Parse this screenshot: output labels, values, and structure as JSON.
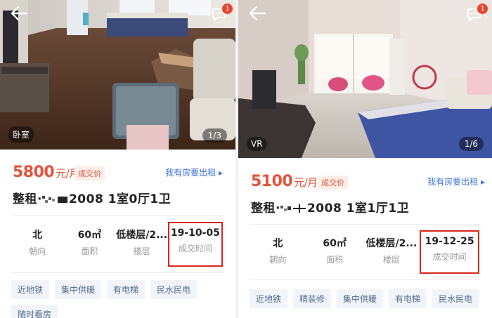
{
  "listings": [
    {
      "photo": {
        "room_tag": "卧室",
        "pager": "1/3"
      },
      "message_badge": "1",
      "price_value": "5800",
      "price_unit": "元/月",
      "deal_tag": "成交价",
      "rent_link": "我有房要出租 ▸",
      "title_prefix": "整租·",
      "title_suffix": "2008 1室0厅1卫",
      "stats": [
        {
          "value": "北",
          "label": "朝向"
        },
        {
          "value": "60㎡",
          "label": "面积"
        },
        {
          "value": "低楼层/2...",
          "label": "楼层"
        },
        {
          "value": "19-10-05",
          "label": "成交时间"
        }
      ],
      "tags": [
        "近地铁",
        "集中供暖",
        "有电梯",
        "民水民电",
        "随时看房"
      ]
    },
    {
      "photo": {
        "room_tag": "VR",
        "pager": "1/6"
      },
      "message_badge": "1",
      "price_value": "5100",
      "price_unit": "元/月",
      "deal_tag": "成交价",
      "rent_link": "我有房要出租 ▸",
      "title_prefix": "整租·",
      "title_suffix": "2008 1室1厅1卫",
      "stats": [
        {
          "value": "北",
          "label": "朝向"
        },
        {
          "value": "60㎡",
          "label": "面积"
        },
        {
          "value": "低楼层/2...",
          "label": "楼层"
        },
        {
          "value": "19-12-25",
          "label": "成交时间"
        }
      ],
      "tags": [
        "近地铁",
        "精装修",
        "集中供暖",
        "有电梯",
        "民水民电"
      ]
    }
  ],
  "colors": {
    "price": "#e5533a",
    "link": "#3d72d8",
    "highlight_box": "#d9261c",
    "tag_bg": "#f1f4f9"
  }
}
